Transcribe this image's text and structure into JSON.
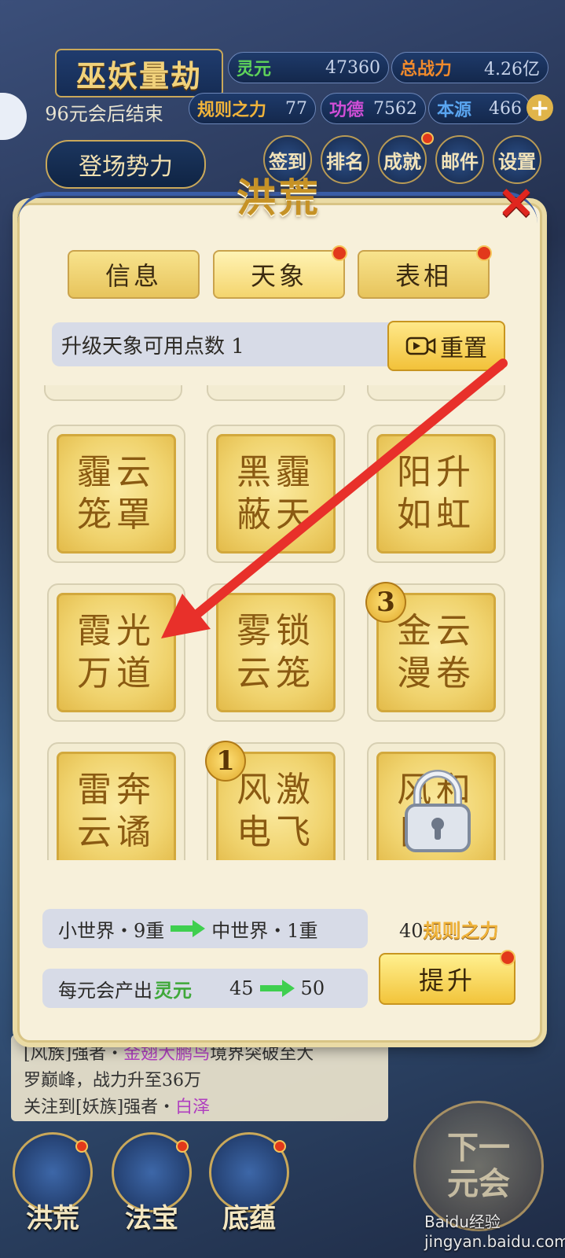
{
  "hud": {
    "title": "巫妖量劫",
    "end_text": "96元会后结束",
    "stats": [
      {
        "label": "灵元",
        "value": "47360",
        "color": "#5fd35a"
      },
      {
        "label": "总战力",
        "value": "4.26亿",
        "color": "#f08a2c"
      },
      {
        "label": "规则之力",
        "value": "77",
        "color": "#f0b33a"
      },
      {
        "label": "功德",
        "value": "7562",
        "color": "#d04ed6"
      },
      {
        "label": "本源",
        "value": "466",
        "color": "#5aa5f0"
      }
    ],
    "debut_label": "登场势力",
    "menu": [
      {
        "label": "签到"
      },
      {
        "label": "排名"
      },
      {
        "label": "成就"
      },
      {
        "label": "邮件"
      },
      {
        "label": "设置"
      }
    ]
  },
  "modal": {
    "title": "洪荒",
    "close_icon": "close-icon",
    "tabs": [
      {
        "label": "信息",
        "active": false,
        "dot": false
      },
      {
        "label": "天象",
        "active": true,
        "dot": true
      },
      {
        "label": "表相",
        "active": false,
        "dot": true
      }
    ],
    "points_label": "升级天象可用点数  1",
    "reset_label": "重置",
    "tiles": [
      {
        "text": "霾云\n笼罩",
        "badge": ""
      },
      {
        "text": "黑霾\n蔽天",
        "badge": ""
      },
      {
        "text": "阳升\n如虹",
        "badge": ""
      },
      {
        "text": "霞光\n万道",
        "badge": ""
      },
      {
        "text": "雾锁\n云笼",
        "badge": ""
      },
      {
        "text": "金云\n漫卷",
        "badge": "3"
      },
      {
        "text": "雷奔\n云谲",
        "badge": ""
      },
      {
        "text": "风激\n电飞",
        "badge": "1"
      },
      {
        "text": "风和\n日暖",
        "badge": "",
        "locked": true
      }
    ],
    "world_from": "小世界・9重",
    "world_to": "中世界・1重",
    "cost_value": "40",
    "cost_label": "规则之力",
    "output_label": "每元会产出",
    "output_resource": "灵元",
    "output_from": "45",
    "output_to": "50",
    "upgrade_label": "提升"
  },
  "log": {
    "line1_prefix": "[风族]强者・",
    "line1_name": "金翅大鹏鸟",
    "line1_suffix": "境界突破至大",
    "line2": "罗巅峰，战力升至36万",
    "line3_prefix": "关注到[妖族]强者・",
    "line3_name": "白泽"
  },
  "bottom_nav": [
    {
      "label": "洪荒"
    },
    {
      "label": "法宝"
    },
    {
      "label": "底蕴"
    }
  ],
  "next_label": "下一元会",
  "watermark": "Baidu经验 jingyan.baidu.com"
}
